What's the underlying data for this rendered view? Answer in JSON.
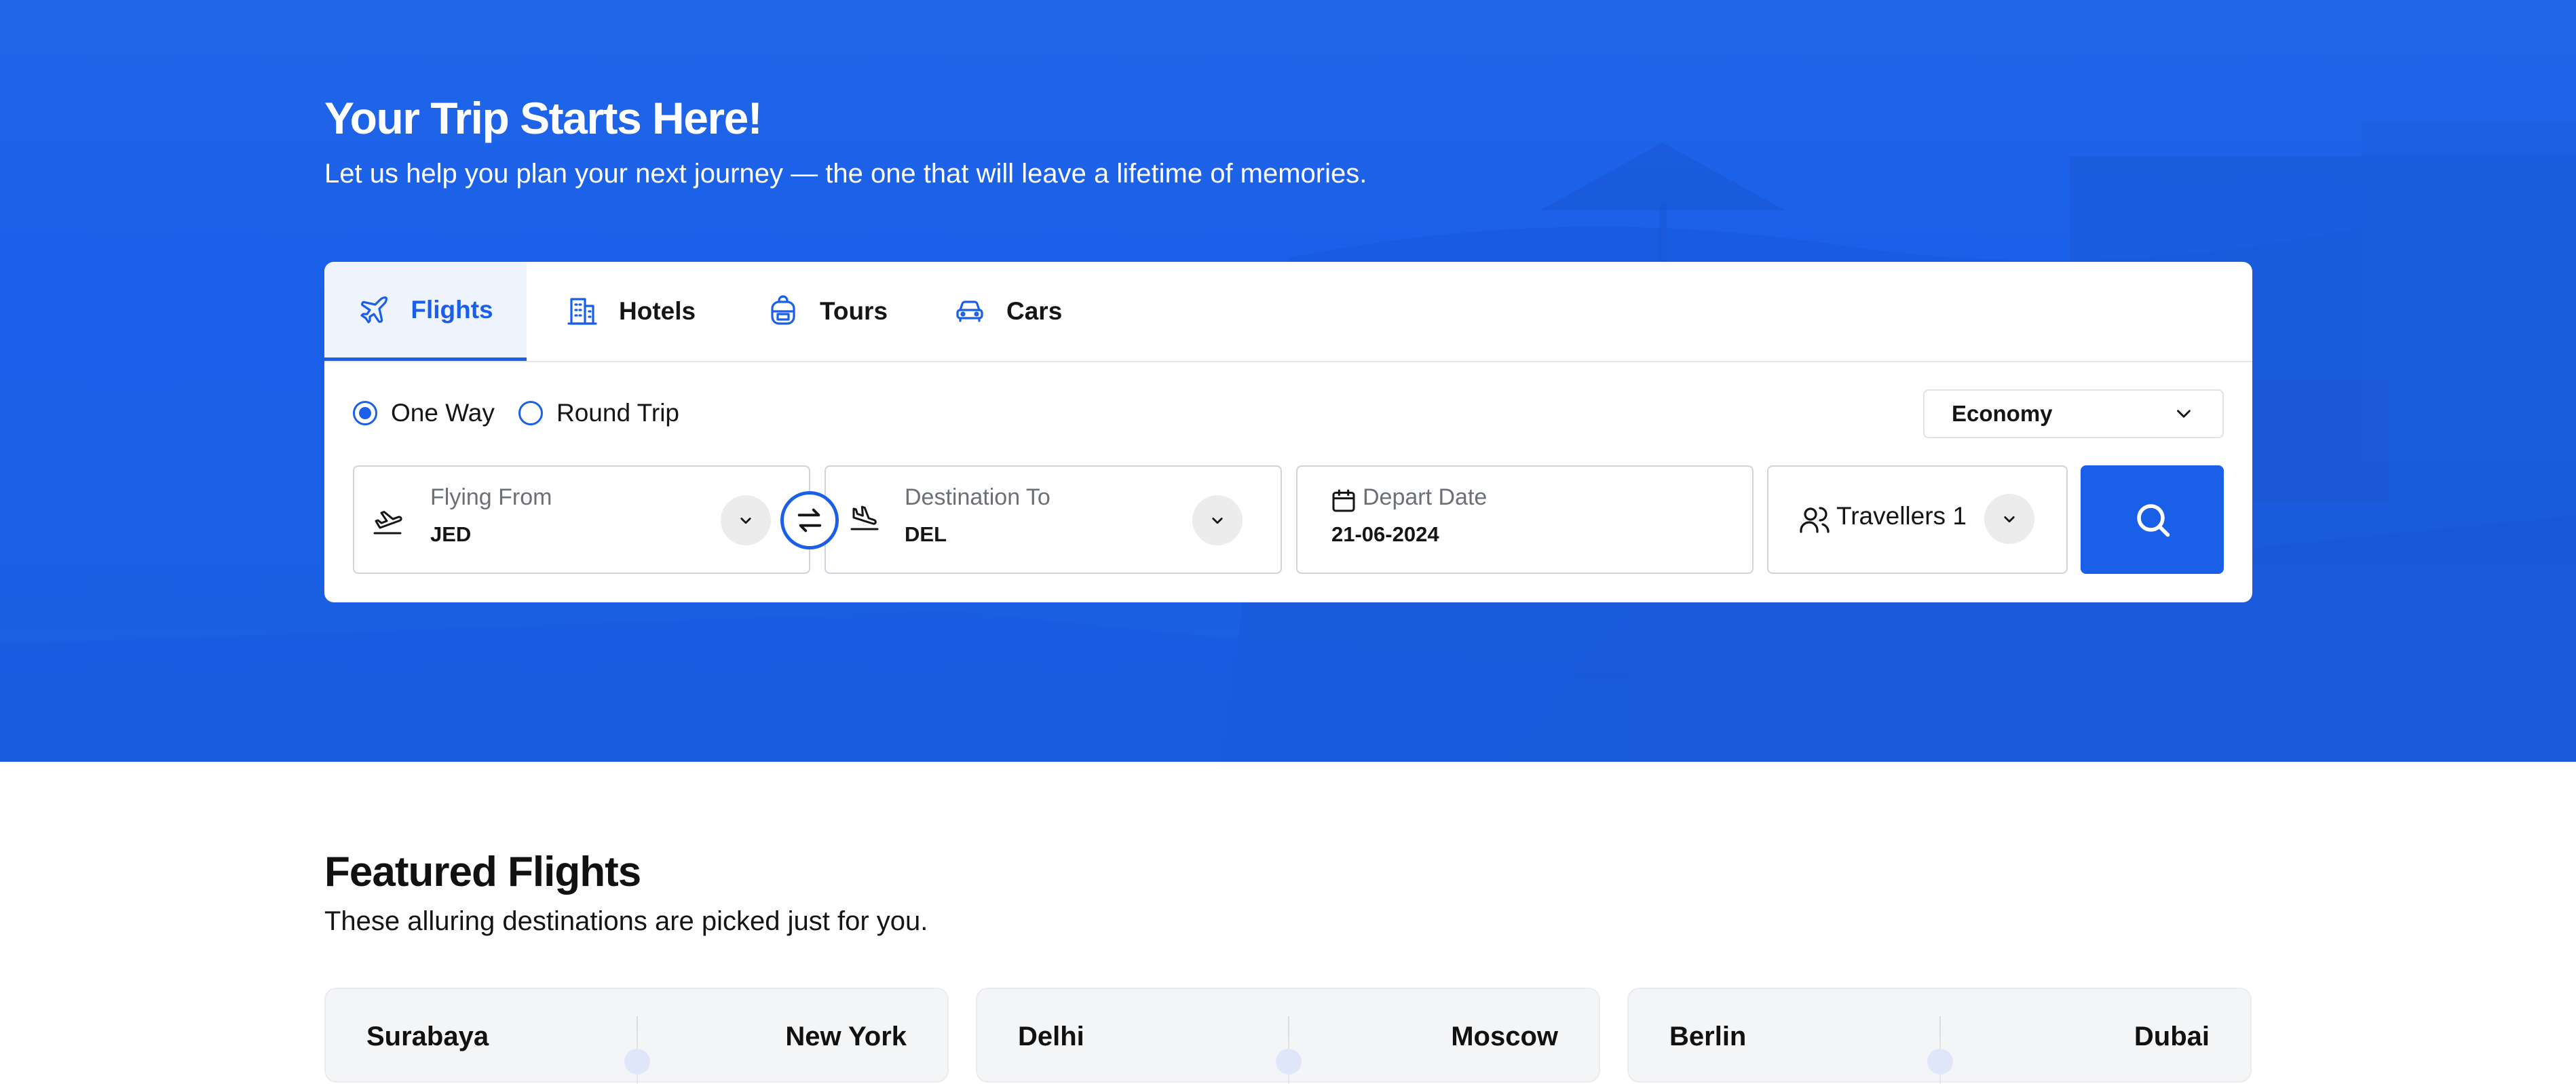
{
  "hero": {
    "title": "Your Trip Starts Here!",
    "subtitle": "Let us help you plan your next journey — the one that will leave a lifetime of memories."
  },
  "search": {
    "tabs": [
      {
        "label": "Flights",
        "icon": "plane-icon",
        "active": true
      },
      {
        "label": "Hotels",
        "icon": "building-icon",
        "active": false
      },
      {
        "label": "Tours",
        "icon": "backpack-icon",
        "active": false
      },
      {
        "label": "Cars",
        "icon": "car-icon",
        "active": false
      }
    ],
    "trip_type": {
      "one_way": "One Way",
      "round_trip": "Round Trip",
      "selected": "One Way"
    },
    "cabin_class": "Economy",
    "from": {
      "label": "Flying From",
      "value": "JED"
    },
    "to": {
      "label": "Destination To",
      "value": "DEL"
    },
    "depart": {
      "label": "Depart Date",
      "value": "21-06-2024"
    },
    "travellers": {
      "label": "Travellers 1"
    }
  },
  "featured": {
    "title": "Featured Flights",
    "subtitle": "These alluring destinations are picked just for you.",
    "cards": [
      {
        "from": "Surabaya",
        "to": "New York"
      },
      {
        "from": "Delhi",
        "to": "Moscow"
      },
      {
        "from": "Berlin",
        "to": "Dubai"
      }
    ]
  },
  "colors": {
    "primary": "#1a5fe8",
    "hero_bg": "#1f63e6",
    "field_border": "#cfd4dc",
    "chevron_bg": "#ececec"
  }
}
